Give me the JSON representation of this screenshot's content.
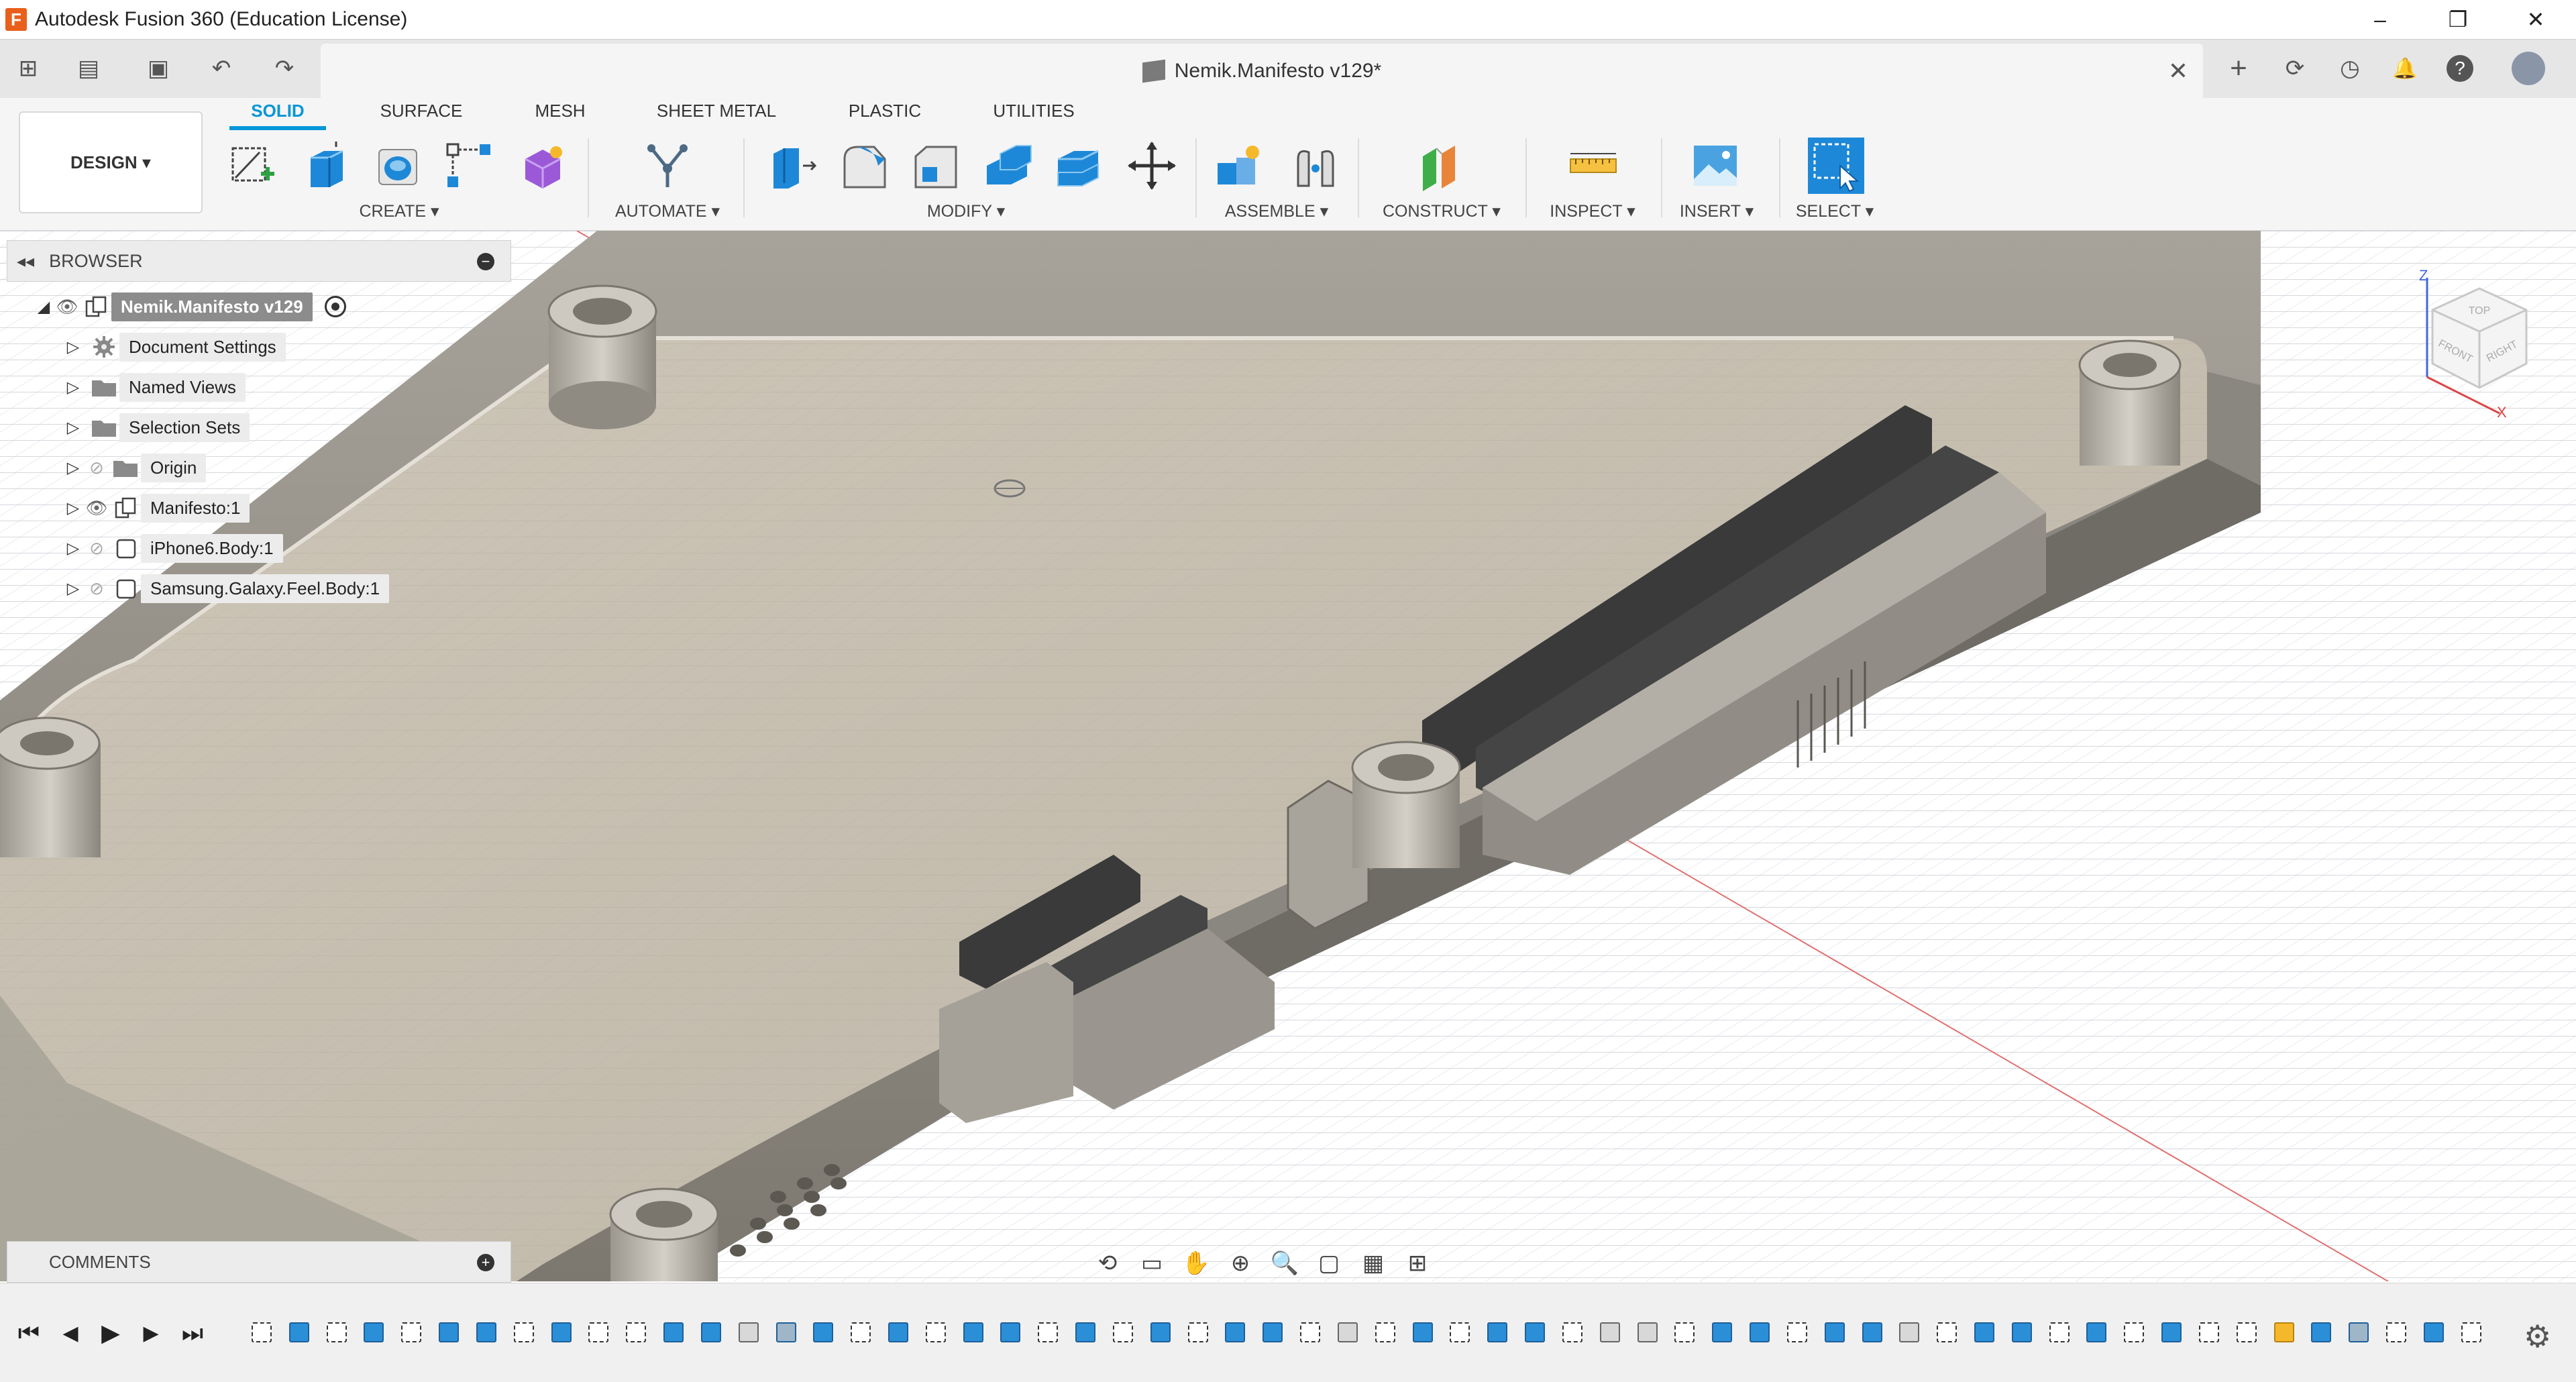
{
  "window": {
    "title": "Autodesk Fusion 360 (Education License)",
    "app_icon": "F",
    "controls": {
      "minimize": "–",
      "restore": "❐",
      "close": "✕"
    }
  },
  "quick_access": {
    "grid_icon": "⊞",
    "file_icon": "▤",
    "save_icon": "▣",
    "undo_icon": "↶",
    "redo_icon": "↷",
    "document_tab": "Nemik.Manifesto v129*",
    "tab_close": "✕",
    "right_icons": {
      "new_tab": "+",
      "refresh": "⟳",
      "history": "◷",
      "notifications": "🔔",
      "help": "?",
      "profile": "●"
    }
  },
  "toolbar": {
    "workspace_button": "DESIGN ▾",
    "tabs": [
      "SOLID",
      "SURFACE",
      "MESH",
      "SHEET METAL",
      "PLASTIC",
      "UTILITIES"
    ],
    "active_tab": "SOLID",
    "groups": [
      "CREATE ▾",
      "AUTOMATE ▾",
      "MODIFY ▾",
      "ASSEMBLE ▾",
      "CONSTRUCT ▾",
      "INSPECT ▾",
      "INSERT ▾",
      "SELECT ▾"
    ]
  },
  "browser": {
    "title": "BROWSER",
    "collapse_icon": "◂◂",
    "minus_icon": "−",
    "root": "Nemik.Manifesto v129",
    "items": [
      {
        "label": "Document Settings"
      },
      {
        "label": "Named Views"
      },
      {
        "label": "Selection Sets"
      },
      {
        "label": "Origin"
      },
      {
        "label": "Manifesto:1"
      },
      {
        "label": "iPhone6.Body:1"
      },
      {
        "label": "Samsung.Galaxy.Feel.Body:1"
      }
    ]
  },
  "viewcube": {
    "top": "TOP",
    "front": "FRONT",
    "right": "RIGHT",
    "axis_z": "Z",
    "axis_x": "X"
  },
  "comments": {
    "title": "COMMENTS",
    "plus_icon": "+"
  },
  "navbar": {
    "orbit": "⟲",
    "look": "▭",
    "pan": "✋",
    "zoom": "⊕",
    "fit": "🔍",
    "display": "▢",
    "grid": "▦",
    "viewports": "⊞"
  },
  "timeline": {
    "first": "⏮",
    "prev": "◀",
    "play": "▶",
    "next": "▶",
    "last": "⏭",
    "gear_icon": "⚙"
  },
  "colors": {
    "accent": "#0696d7",
    "model_floor": "#c9c2b5",
    "model_wall": "#8f8b83",
    "model_dark": "#3d3d3d",
    "grid_line": "#d9dde3"
  }
}
